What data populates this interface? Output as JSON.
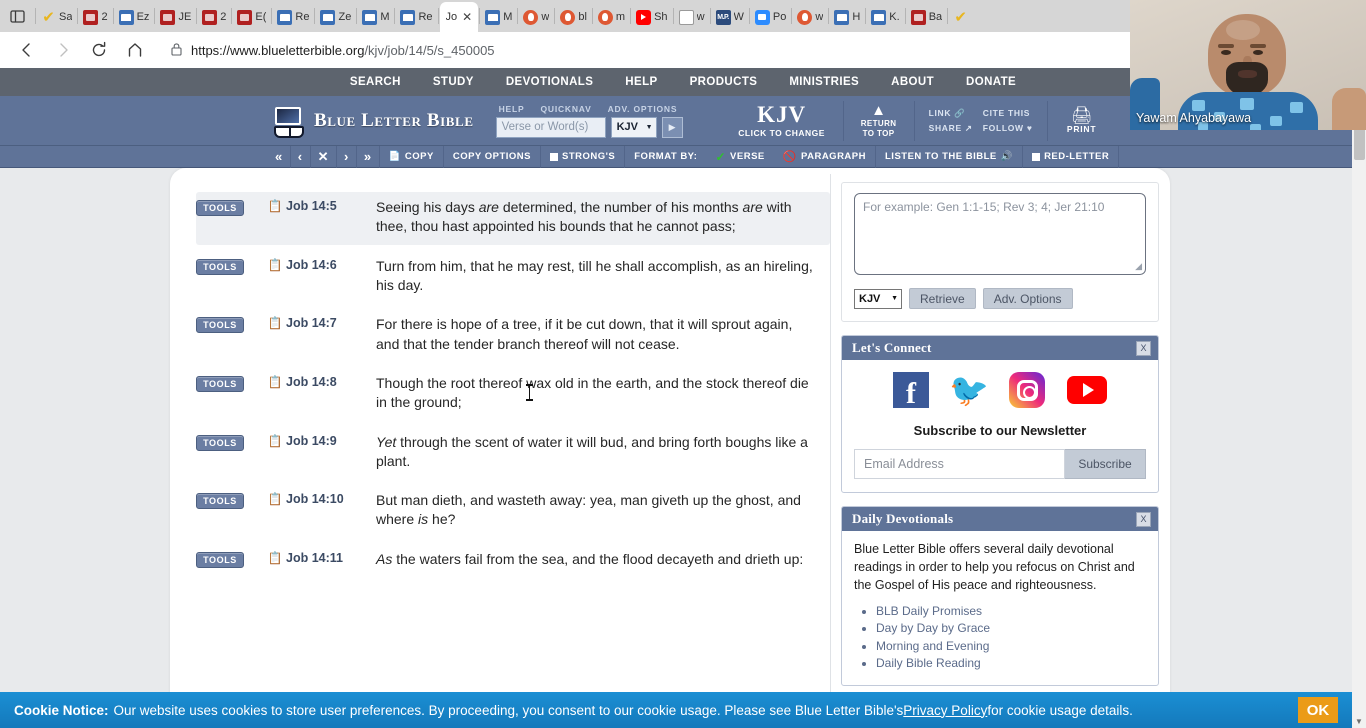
{
  "browser": {
    "tabs": [
      {
        "label": "Sa",
        "icon": "check-icon",
        "active": false
      },
      {
        "label": "2",
        "icon": "blb-icon",
        "active": false
      },
      {
        "label": "Ez",
        "icon": "book-icon",
        "active": false
      },
      {
        "label": "JE",
        "icon": "blb-icon",
        "active": false
      },
      {
        "label": "2",
        "icon": "blb-icon",
        "active": false
      },
      {
        "label": "E(",
        "icon": "blb-icon",
        "active": false
      },
      {
        "label": "Re",
        "icon": "book-icon",
        "active": false
      },
      {
        "label": "Ze",
        "icon": "book-icon",
        "active": false
      },
      {
        "label": "M",
        "icon": "book-icon",
        "active": false
      },
      {
        "label": "Re",
        "icon": "book-icon",
        "active": false
      },
      {
        "label": "Jo",
        "icon": "none",
        "active": true
      },
      {
        "label": "M",
        "icon": "book-icon",
        "active": false
      },
      {
        "label": "w",
        "icon": "duckduckgo-icon",
        "active": false
      },
      {
        "label": "bl",
        "icon": "duckduckgo-icon",
        "active": false
      },
      {
        "label": "m",
        "icon": "duckduckgo-icon",
        "active": false
      },
      {
        "label": "Sh",
        "icon": "youtube-icon",
        "active": false
      },
      {
        "label": "w",
        "icon": "document-icon",
        "active": false
      },
      {
        "label": "W",
        "icon": "mp-icon",
        "active": false
      },
      {
        "label": "Po",
        "icon": "zoom-icon",
        "active": false
      },
      {
        "label": "w",
        "icon": "duckduckgo-icon",
        "active": false
      },
      {
        "label": "H",
        "icon": "book-icon",
        "active": false
      },
      {
        "label": "K.",
        "icon": "book-icon",
        "active": false
      },
      {
        "label": "Ba",
        "icon": "blb-icon",
        "active": false
      },
      {
        "label": "",
        "icon": "check-icon",
        "active": false
      }
    ],
    "tab_close_label": "✕",
    "url_protocol": "https://www.blueletterbible.org",
    "url_path": "/kjv/job/14/5/s_450005",
    "nav": {
      "back": "back-arrow",
      "forward": "forward-arrow",
      "reload": "reload-icon",
      "home": "home-icon"
    },
    "toolbar_icons": [
      "read-aloud-icon",
      "add-favorite-icon",
      "extension-check-icon",
      "shield-extension-icon"
    ]
  },
  "site": {
    "nav_items": [
      "SEARCH",
      "STUDY",
      "DEVOTIONALS",
      "HELP",
      "PRODUCTS",
      "MINISTRIES",
      "ABOUT",
      "DONATE"
    ],
    "brand": "Blue Letter Bible",
    "header_links": [
      "HELP",
      "QUICKNAV",
      "ADV. OPTIONS"
    ],
    "search_placeholder": "Verse or Word(s)",
    "version_select": "KJV",
    "go_label": "▶",
    "kjv_big": "KJV",
    "kjv_small": "CLICK TO CHANGE",
    "return_to_top_line1": "RETURN",
    "return_to_top_line2": "TO TOP",
    "link_label": "LINK",
    "cite_label": "CITE THIS",
    "share_label": "SHARE",
    "follow_label": "FOLLOW",
    "print_label": "PRINT"
  },
  "toolbar": {
    "first_label": "«",
    "prev_label": "‹",
    "down_label": "✕",
    "next_label": "›",
    "last_label": "»",
    "copy_label": "COPY",
    "copy_options_label": "COPY OPTIONS",
    "strongs_label": "STRONG'S",
    "format_by_label": "FORMAT BY:",
    "verse_label": "VERSE",
    "paragraph_label": "PARAGRAPH",
    "listen_label": "LISTEN TO THE BIBLE",
    "red_letter_label": "RED-LETTER"
  },
  "verses": [
    {
      "tools": "TOOLS",
      "ref": "Job 14:5",
      "highlighted": true,
      "html": "Seeing his days <i>are</i> determined, the number of his months <i>are</i> with thee, thou hast appointed his bounds that he cannot pass;"
    },
    {
      "tools": "TOOLS",
      "ref": "Job 14:6",
      "highlighted": false,
      "html": "Turn from him, that he may rest, till he shall accomplish, as an hireling, his day."
    },
    {
      "tools": "TOOLS",
      "ref": "Job 14:7",
      "highlighted": false,
      "html": "For there is hope of a tree, if it be cut down, that it will sprout again, and that the tender branch thereof will not cease."
    },
    {
      "tools": "TOOLS",
      "ref": "Job 14:8",
      "highlighted": false,
      "html": "Though the root thereof wax old in the earth, and the stock thereof die in the ground;"
    },
    {
      "tools": "TOOLS",
      "ref": "Job 14:9",
      "highlighted": false,
      "html": "<i>Yet</i> through the scent of water it will bud, and bring forth boughs like a plant."
    },
    {
      "tools": "TOOLS",
      "ref": "Job 14:10",
      "highlighted": false,
      "html": "But man dieth, and wasteth away: yea, man giveth up the ghost, and where <i>is</i> he?"
    },
    {
      "tools": "TOOLS",
      "ref": "Job 14:11",
      "highlighted": false,
      "html": "<i>As</i> the waters fail from the sea, and the flood decayeth and drieth up:"
    }
  ],
  "rail": {
    "search": {
      "placeholder": "For example: Gen 1:1-15; Rev 3; 4; Jer 21:10",
      "value": "",
      "version": "KJV",
      "retrieve_label": "Retrieve",
      "adv_options_label": "Adv. Options"
    },
    "connect": {
      "title": "Let's Connect",
      "close_label": "X",
      "socials": [
        "facebook-icon",
        "twitter-icon",
        "instagram-icon",
        "youtube-icon"
      ],
      "newsletter_title": "Subscribe to our Newsletter",
      "email_placeholder": "Email Address",
      "subscribe_label": "Subscribe"
    },
    "devotionals": {
      "title": "Daily Devotionals",
      "close_label": "X",
      "body": "Blue Letter Bible offers several daily devotional readings in order to help you refocus on Christ and the Gospel of His peace and righteousness.",
      "links": [
        "BLB Daily Promises",
        "Day by Day by Grace",
        "Morning and Evening",
        "Daily Bible Reading"
      ]
    }
  },
  "cookie": {
    "label": "Cookie Notice:",
    "text_before": "Our website uses cookies to store user preferences. By proceeding, you consent to our cookie usage. Please see Blue Letter Bible's ",
    "link": "Privacy Policy",
    "text_after": " for cookie usage details.",
    "ok_label": "OK"
  },
  "webcam": {
    "name": "Yawam Ahyabayawa"
  },
  "colors": {
    "site_blue": "#5f7398",
    "nav_grey": "#5d646e",
    "cookie_blue": "#1b8fd4",
    "ok_orange": "#eb9b18"
  }
}
